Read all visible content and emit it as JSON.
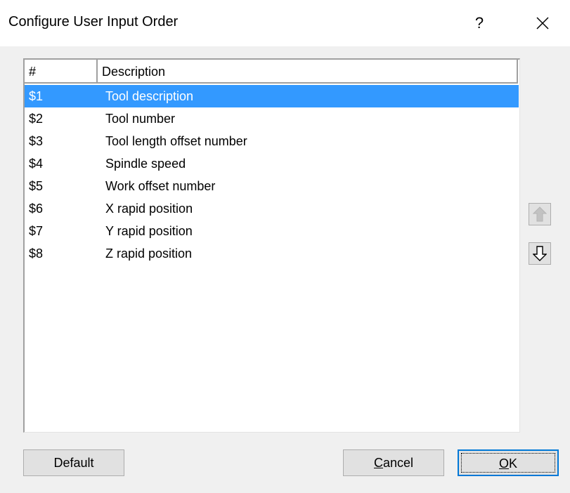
{
  "window": {
    "title": "Configure User Input Order",
    "help_label": "?",
    "close_icon": "close-icon"
  },
  "list": {
    "columns": [
      "#",
      "Description"
    ],
    "selected_index": 0,
    "rows": [
      {
        "num": "$1",
        "description": "Tool description"
      },
      {
        "num": "$2",
        "description": "Tool number"
      },
      {
        "num": "$3",
        "description": "Tool length offset number"
      },
      {
        "num": "$4",
        "description": "Spindle speed"
      },
      {
        "num": "$5",
        "description": "Work offset number"
      },
      {
        "num": "$6",
        "description": "X rapid position"
      },
      {
        "num": "$7",
        "description": "Y rapid position"
      },
      {
        "num": "$8",
        "description": "Z rapid position"
      }
    ]
  },
  "side_buttons": {
    "move_up": {
      "icon": "arrow-up-icon",
      "enabled": false
    },
    "move_down": {
      "icon": "arrow-down-icon",
      "enabled": true
    }
  },
  "buttons": {
    "default_label": "Default",
    "cancel_label": "Cancel",
    "ok_label": "OK"
  },
  "colors": {
    "selection": "#3399ff",
    "focus_border": "#0078d7"
  }
}
